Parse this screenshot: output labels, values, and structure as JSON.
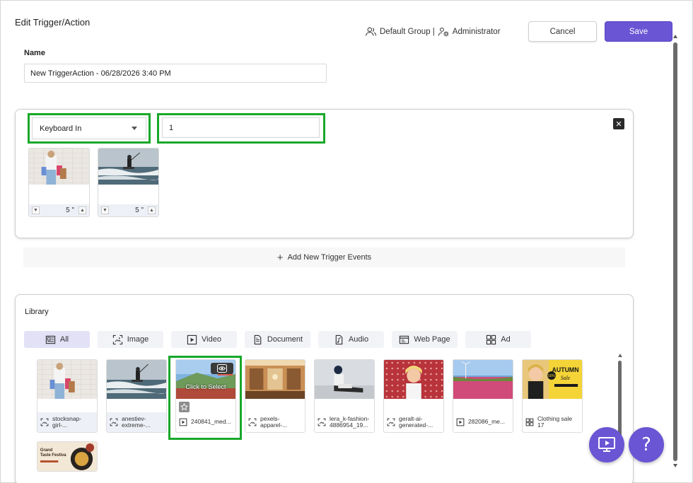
{
  "header": {
    "title": "Edit Trigger/Action",
    "group": "Default Group |",
    "role": "Administrator",
    "cancel_label": "Cancel",
    "save_label": "Save"
  },
  "name_field": {
    "label": "Name",
    "value": "New TriggerAction - 06/28/2026 3:40 PM"
  },
  "trigger": {
    "type_selected": "Keyboard In",
    "key_value": "1",
    "items": [
      {
        "duration": "5 \"",
        "icon": "image"
      },
      {
        "duration": "5 \"",
        "icon": "image"
      }
    ]
  },
  "add_events_label": "Add New Trigger Events",
  "library": {
    "title": "Library",
    "tabs": [
      {
        "label": "All",
        "icon": "all-icon"
      },
      {
        "label": "Image",
        "icon": "image-icon"
      },
      {
        "label": "Video",
        "icon": "video-icon"
      },
      {
        "label": "Document",
        "icon": "document-icon"
      },
      {
        "label": "Audio",
        "icon": "audio-icon"
      },
      {
        "label": "Web Page",
        "icon": "web-page-icon"
      },
      {
        "label": "Ad",
        "icon": "ad-icon"
      }
    ],
    "items": [
      {
        "name": "stocksnap-girl-...",
        "type": "image"
      },
      {
        "name": "anestiev-extreme-...",
        "type": "image"
      },
      {
        "name": "240841_med...",
        "type": "video",
        "overlay": "Click to Select"
      },
      {
        "name": "pexels-apparel-...",
        "type": "image"
      },
      {
        "name": "lera_k-fashion-4886954_19...",
        "type": "image"
      },
      {
        "name": "geralt-ai-generated-...",
        "type": "image"
      },
      {
        "name": "282086_me...",
        "type": "video"
      },
      {
        "name": "Clothing sale 17",
        "type": "ad"
      },
      {
        "name": "",
        "type": "image"
      }
    ],
    "thumb_texts": {
      "autumn": "AUTUMN",
      "sale": "Sale",
      "percent": "50%",
      "festival_line1": "Grand",
      "festival_line2": "Taste Festiva"
    }
  },
  "colors": {
    "accent": "#6a55d4",
    "highlight": "#19a82a",
    "tab_active": "#e3e1f6"
  }
}
